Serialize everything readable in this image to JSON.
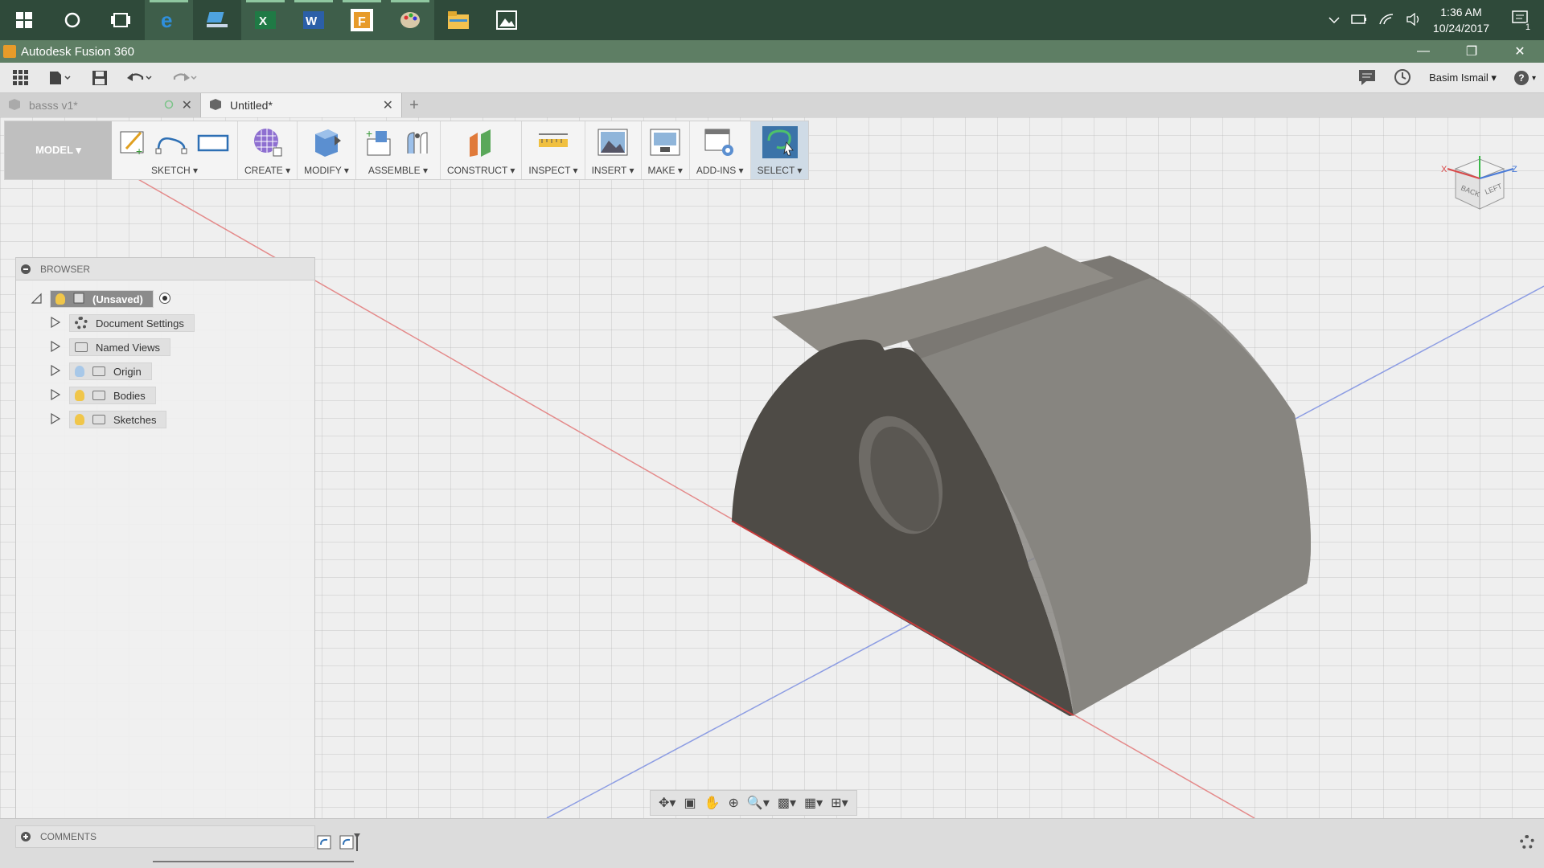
{
  "window": {
    "title": "Autodesk Fusion 360"
  },
  "taskbar": {
    "time": "1:36 AM",
    "date": "10/24/2017",
    "notifications": "1"
  },
  "app_toolbar": {
    "user": "Basim Ismail ▾",
    "help": "?"
  },
  "tabs": [
    {
      "label": "basss v1*"
    },
    {
      "label": "Untitled*"
    }
  ],
  "ribbon": {
    "workspace": "MODEL ▾",
    "groups": [
      "SKETCH ▾",
      "CREATE ▾",
      "MODIFY ▾",
      "ASSEMBLE ▾",
      "CONSTRUCT ▾",
      "INSPECT ▾",
      "INSERT ▾",
      "MAKE ▾",
      "ADD-INS ▾",
      "SELECT ▾"
    ]
  },
  "viewcube": {
    "back": "BACK",
    "left": "LEFT",
    "x": "X",
    "z": "Z"
  },
  "browser": {
    "title": "BROWSER",
    "root": "(Unsaved)",
    "items": [
      "Document Settings",
      "Named Views",
      "Origin",
      "Bodies",
      "Sketches"
    ]
  },
  "comments": {
    "title": "COMMENTS"
  },
  "colors": {
    "accent": "#5e7e64",
    "taskbar": "#2f4a3a",
    "model_face": "#6a6762",
    "axis_red": "#e07a7a",
    "axis_blue": "#7a8ee0"
  }
}
